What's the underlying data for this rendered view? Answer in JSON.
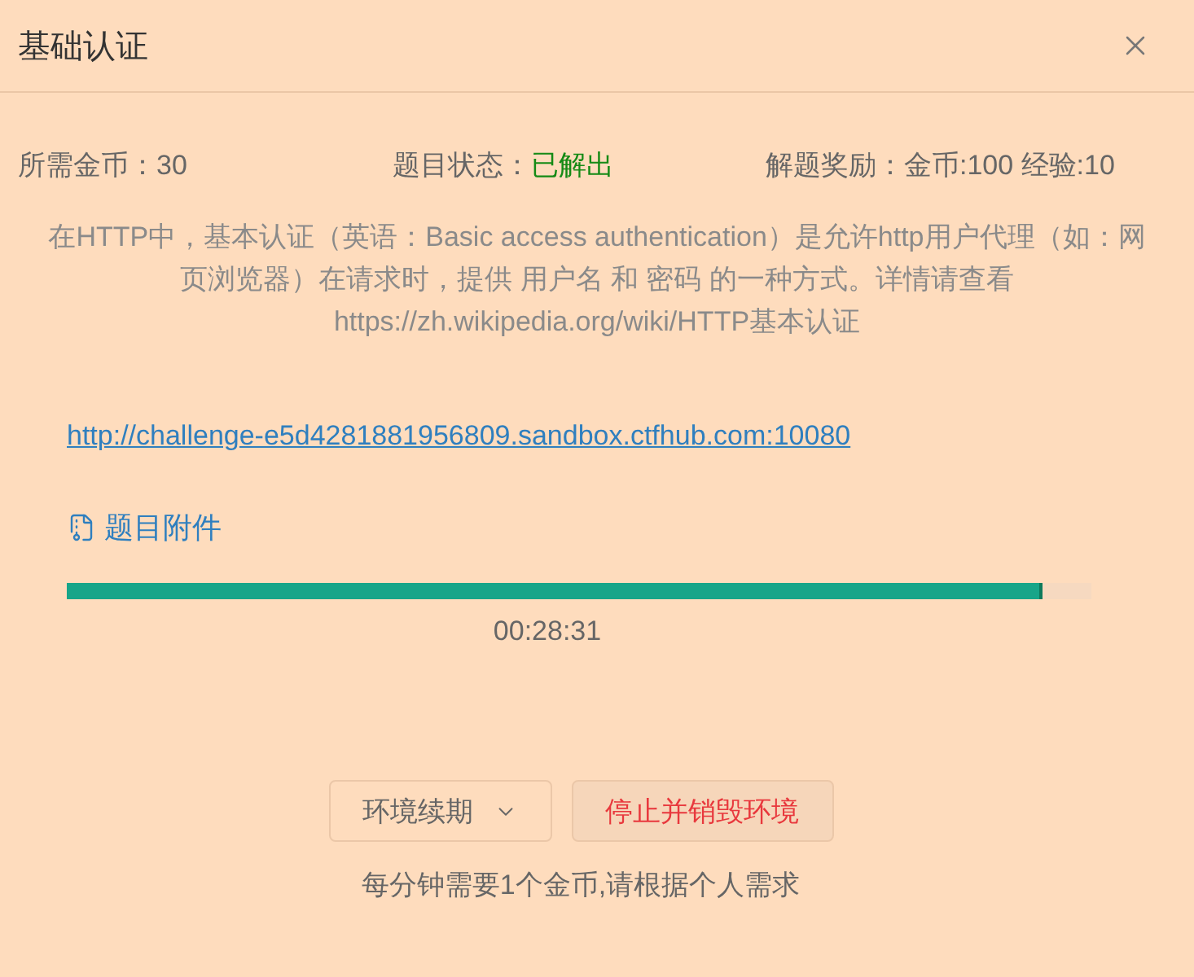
{
  "dialog": {
    "title": "基础认证"
  },
  "stats": [
    {
      "kind": "plain",
      "label": "所需金币：",
      "value": "30"
    },
    {
      "kind": "status",
      "label": "题目状态：",
      "value": "已解出"
    },
    {
      "kind": "plain",
      "label": "解题奖励：",
      "value": "金币:100 经验:10"
    }
  ],
  "description": "在HTTP中，基本认证（英语：Basic access authentication）是允许http用户代理（如：网页浏览器）在请求时，提供 用户名 和 密码 的一种方式。详情请查看https://zh.wikipedia.org/wiki/HTTP基本认证",
  "link": "http://challenge-e5d4281881956809.sandbox.ctfhub.com:10080",
  "attachment": {
    "label": "题目附件"
  },
  "timer": {
    "level": 0.953,
    "time": "00:28:31"
  },
  "buttons": [
    {
      "kind": "dropdown",
      "label": "环境续期"
    },
    {
      "kind": "danger",
      "label": "停止并销毁环境"
    }
  ],
  "note": "每分钟需要1个金币,请根据个人需求"
}
